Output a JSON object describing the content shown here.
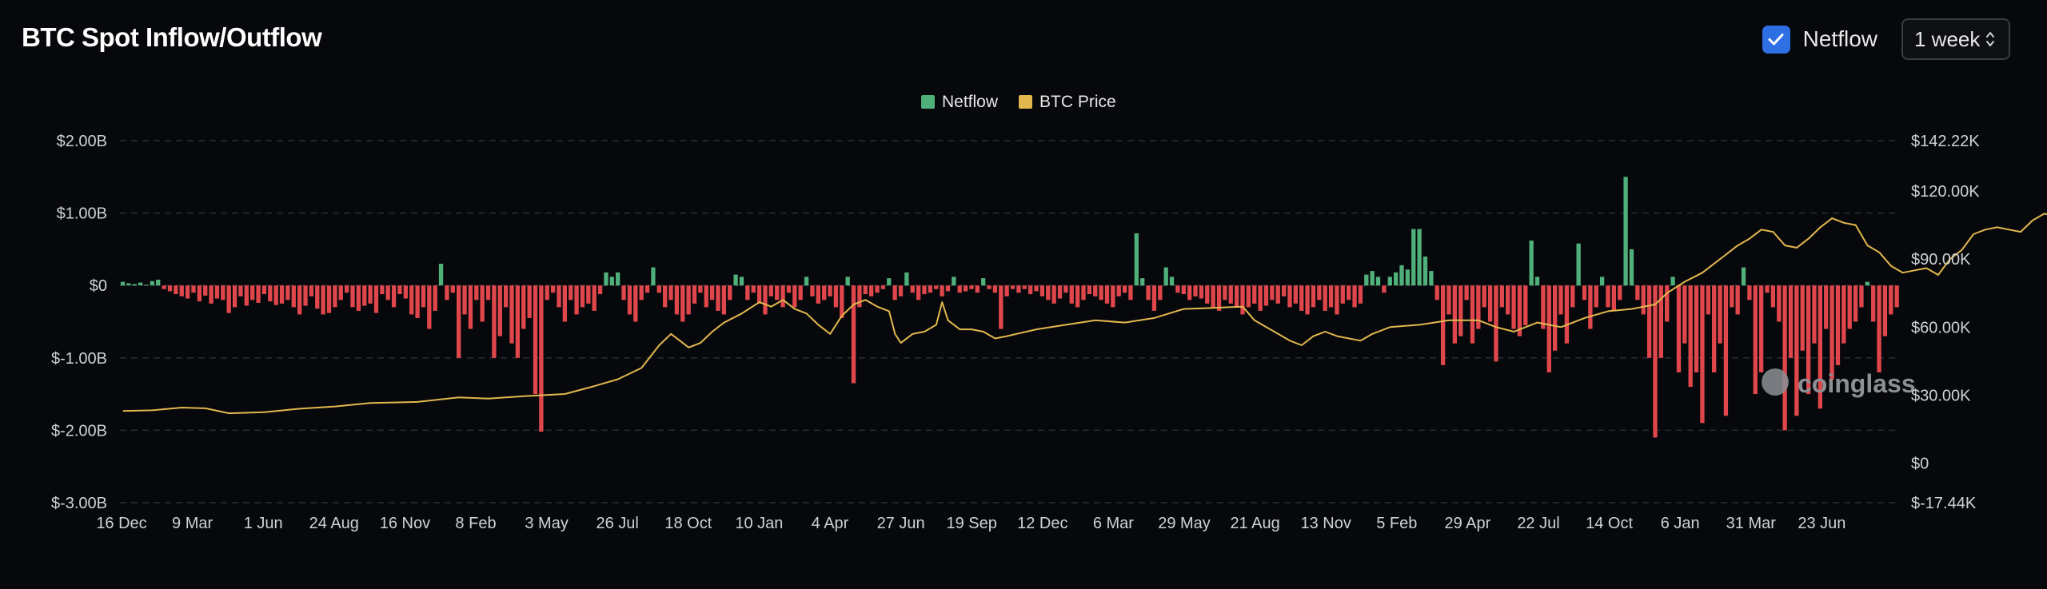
{
  "header": {
    "title": "BTC Spot Inflow/Outflow",
    "netflow_toggle_label": "Netflow",
    "netflow_checked": true,
    "period_value": "1 week"
  },
  "watermark": "coinglass",
  "colors": {
    "inflow": "#4fb07a",
    "outflow": "#e0474c",
    "price": "#e2b84e",
    "checkbox": "#2f6fe4"
  },
  "chart_data": {
    "type": "bar",
    "legend": [
      "Netflow",
      "BTC Price"
    ],
    "legend_position": "top-center",
    "grid": true,
    "x_tick_labels": [
      "16 Dec",
      "9 Mar",
      "1 Jun",
      "24 Aug",
      "16 Nov",
      "8 Feb",
      "3 May",
      "26 Jul",
      "18 Oct",
      "10 Jan",
      "4 Apr",
      "27 Jun",
      "19 Sep",
      "12 Dec",
      "6 Mar",
      "29 May",
      "21 Aug",
      "13 Nov",
      "5 Feb",
      "29 Apr",
      "22 Jul",
      "14 Oct",
      "6 Jan",
      "31 Mar",
      "23 Jun"
    ],
    "y_left": {
      "tick_labels": [
        "$2.00B",
        "$1.00B",
        "$0",
        "$-1.00B",
        "$-2.00B",
        "$-3.00B"
      ],
      "range": [
        -3,
        2
      ],
      "unit": "USD billions"
    },
    "y_right": {
      "tick_labels": [
        "$142.22K",
        "$120.00K",
        "$90.00K",
        "$60.00K",
        "$30.00K",
        "$0",
        "$-17.44K"
      ],
      "range": [
        -17.44,
        142.22
      ],
      "unit": "USD thousands"
    },
    "series": [
      {
        "name": "Netflow",
        "kind": "bar",
        "unit": "USD billions",
        "values": [
          0.05,
          0.03,
          0.02,
          0.04,
          0.01,
          0.06,
          0.08,
          -0.05,
          -0.08,
          -0.12,
          -0.15,
          -0.18,
          -0.1,
          -0.22,
          -0.14,
          -0.25,
          -0.18,
          -0.2,
          -0.38,
          -0.3,
          -0.15,
          -0.28,
          -0.2,
          -0.24,
          -0.12,
          -0.22,
          -0.27,
          -0.25,
          -0.2,
          -0.3,
          -0.4,
          -0.28,
          -0.15,
          -0.32,
          -0.4,
          -0.38,
          -0.3,
          -0.2,
          -0.1,
          -0.3,
          -0.35,
          -0.28,
          -0.25,
          -0.38,
          -0.12,
          -0.2,
          -0.3,
          -0.12,
          -0.18,
          -0.4,
          -0.45,
          -0.3,
          -0.6,
          -0.35,
          0.3,
          -0.2,
          -0.1,
          -1.0,
          -0.4,
          -0.6,
          -0.2,
          -0.5,
          -0.2,
          -1.0,
          -0.7,
          -0.3,
          -0.8,
          -1.0,
          -0.6,
          -0.45,
          -1.5,
          -2.02,
          -0.2,
          -0.1,
          -0.3,
          -0.5,
          -0.2,
          -0.4,
          -0.3,
          -0.25,
          -0.35,
          -0.12,
          0.18,
          0.12,
          0.18,
          -0.2,
          -0.4,
          -0.5,
          -0.2,
          -0.1,
          0.25,
          -0.1,
          -0.3,
          -0.2,
          -0.4,
          -0.5,
          -0.4,
          -0.25,
          -0.1,
          -0.3,
          -0.2,
          -0.35,
          -0.4,
          -0.2,
          0.15,
          0.12,
          -0.2,
          -0.1,
          -0.25,
          -0.4,
          -0.15,
          -0.2,
          -0.3,
          -0.1,
          -0.3,
          -0.2,
          0.12,
          -0.15,
          -0.25,
          -0.2,
          -0.15,
          -0.3,
          -0.45,
          0.12,
          -1.35,
          -0.3,
          -0.12,
          -0.15,
          -0.1,
          -0.05,
          0.1,
          -0.2,
          -0.15,
          0.18,
          -0.1,
          -0.2,
          -0.12,
          -0.1,
          -0.05,
          -0.15,
          -0.08,
          0.12,
          -0.1,
          -0.08,
          -0.05,
          -0.1,
          0.1,
          -0.05,
          -0.1,
          -0.6,
          -0.15,
          -0.05,
          -0.1,
          -0.05,
          -0.12,
          -0.08,
          -0.15,
          -0.2,
          -0.25,
          -0.18,
          -0.1,
          -0.25,
          -0.3,
          -0.2,
          -0.12,
          -0.15,
          -0.2,
          -0.25,
          -0.3,
          -0.15,
          -0.1,
          -0.2,
          0.72,
          0.1,
          -0.2,
          -0.35,
          -0.2,
          0.25,
          0.12,
          -0.1,
          -0.12,
          -0.2,
          -0.15,
          -0.18,
          -0.25,
          -0.3,
          -0.35,
          -0.2,
          -0.25,
          -0.3,
          -0.4,
          -0.3,
          -0.25,
          -0.35,
          -0.28,
          -0.2,
          -0.25,
          -0.15,
          -0.3,
          -0.25,
          -0.35,
          -0.4,
          -0.3,
          -0.2,
          -0.35,
          -0.3,
          -0.4,
          -0.25,
          -0.2,
          -0.3,
          -0.25,
          0.15,
          0.2,
          0.12,
          -0.1,
          0.12,
          0.18,
          0.28,
          0.22,
          0.78,
          0.78,
          0.4,
          0.2,
          -0.2,
          -1.1,
          -0.4,
          -0.8,
          -0.7,
          -0.2,
          -0.8,
          -0.6,
          -0.3,
          -0.5,
          -1.05,
          -0.3,
          -0.4,
          -0.6,
          -0.7,
          -0.55,
          0.62,
          0.12,
          -0.6,
          -1.2,
          -0.9,
          -0.4,
          -0.8,
          -0.3,
          0.58,
          -0.2,
          -0.6,
          -0.3,
          0.12,
          -0.3,
          -0.35,
          -0.2,
          1.5,
          0.5,
          -0.2,
          -0.4,
          -1.0,
          -2.1,
          -1.0,
          -0.5,
          0.12,
          -1.2,
          -0.8,
          -1.4,
          -1.2,
          -1.9,
          -0.4,
          -1.2,
          -0.8,
          -1.8,
          -0.3,
          -0.4,
          0.25,
          -0.2,
          -1.5,
          -1.2,
          -0.1,
          -0.3,
          -0.5,
          -2.0,
          -1.0,
          -1.8,
          -0.9,
          -1.5,
          -0.8,
          -1.7,
          -0.6,
          -1.3,
          -1.1,
          -0.8,
          -0.6,
          -0.5,
          -0.3,
          0.05,
          -0.5,
          -1.2,
          -0.7,
          -0.4,
          -0.3
        ]
      },
      {
        "name": "BTC Price",
        "kind": "line",
        "unit": "USD thousands",
        "points": [
          [
            0,
            23
          ],
          [
            5,
            23.3
          ],
          [
            10,
            24.5
          ],
          [
            14,
            24.2
          ],
          [
            18,
            22
          ],
          [
            24,
            22.5
          ],
          [
            30,
            24
          ],
          [
            36,
            25
          ],
          [
            42,
            26.5
          ],
          [
            50,
            27
          ],
          [
            57,
            29
          ],
          [
            62,
            28.5
          ],
          [
            68,
            29.5
          ],
          [
            75,
            30.5
          ],
          [
            80,
            34
          ],
          [
            84,
            37
          ],
          [
            88,
            42
          ],
          [
            91,
            52
          ],
          [
            93,
            57
          ],
          [
            96,
            51
          ],
          [
            98,
            53
          ],
          [
            100,
            58
          ],
          [
            102,
            62
          ],
          [
            105,
            66
          ],
          [
            108,
            71
          ],
          [
            110,
            69
          ],
          [
            112,
            72
          ],
          [
            114,
            68
          ],
          [
            116,
            66
          ],
          [
            118,
            61
          ],
          [
            120,
            57
          ],
          [
            122,
            65
          ],
          [
            124,
            70
          ],
          [
            126,
            72
          ],
          [
            128,
            69
          ],
          [
            130,
            67
          ],
          [
            131,
            57
          ],
          [
            132,
            53
          ],
          [
            134,
            57
          ],
          [
            136,
            58
          ],
          [
            138,
            61
          ],
          [
            139,
            71
          ],
          [
            140,
            63
          ],
          [
            142,
            59
          ],
          [
            144,
            59
          ],
          [
            146,
            58
          ],
          [
            148,
            55
          ],
          [
            150,
            56
          ],
          [
            155,
            59
          ],
          [
            160,
            61
          ],
          [
            165,
            63
          ],
          [
            170,
            62
          ],
          [
            175,
            64
          ],
          [
            180,
            68
          ],
          [
            185,
            68.5
          ],
          [
            190,
            69
          ],
          [
            192,
            63
          ],
          [
            194,
            60
          ],
          [
            196,
            57
          ],
          [
            198,
            54
          ],
          [
            200,
            52
          ],
          [
            202,
            56
          ],
          [
            204,
            58
          ],
          [
            206,
            56
          ],
          [
            210,
            54
          ],
          [
            212,
            57
          ],
          [
            215,
            60
          ],
          [
            220,
            61
          ],
          [
            225,
            63
          ],
          [
            230,
            63
          ],
          [
            233,
            60
          ],
          [
            236,
            58
          ],
          [
            240,
            62
          ],
          [
            244,
            60
          ],
          [
            248,
            64
          ],
          [
            252,
            67
          ],
          [
            256,
            68
          ],
          [
            260,
            70
          ],
          [
            262,
            75
          ],
          [
            265,
            80
          ],
          [
            268,
            84
          ],
          [
            270,
            88
          ],
          [
            272,
            92
          ],
          [
            274,
            96
          ],
          [
            276,
            99
          ],
          [
            278,
            103
          ],
          [
            280,
            102
          ],
          [
            282,
            96
          ],
          [
            284,
            95
          ],
          [
            286,
            99
          ],
          [
            288,
            104
          ],
          [
            290,
            108
          ],
          [
            292,
            106
          ],
          [
            294,
            105
          ],
          [
            296,
            96
          ],
          [
            298,
            93
          ],
          [
            300,
            87
          ],
          [
            302,
            84
          ],
          [
            304,
            85
          ],
          [
            306,
            86
          ],
          [
            308,
            83
          ],
          [
            310,
            90
          ],
          [
            312,
            94
          ],
          [
            314,
            101
          ],
          [
            316,
            103
          ],
          [
            318,
            104
          ],
          [
            320,
            103
          ],
          [
            322,
            102
          ],
          [
            324,
            107
          ],
          [
            326,
            110
          ],
          [
            328,
            109
          ],
          [
            330,
            105
          ],
          [
            332,
            108
          ],
          [
            334,
            115
          ],
          [
            336,
            117
          ],
          [
            338,
            116
          ],
          [
            340,
            112
          ],
          [
            342,
            115
          ],
          [
            344,
            113
          ],
          [
            346,
            108
          ],
          [
            348,
            109
          ],
          [
            350,
            112
          ],
          [
            351,
            113
          ]
        ]
      }
    ]
  }
}
